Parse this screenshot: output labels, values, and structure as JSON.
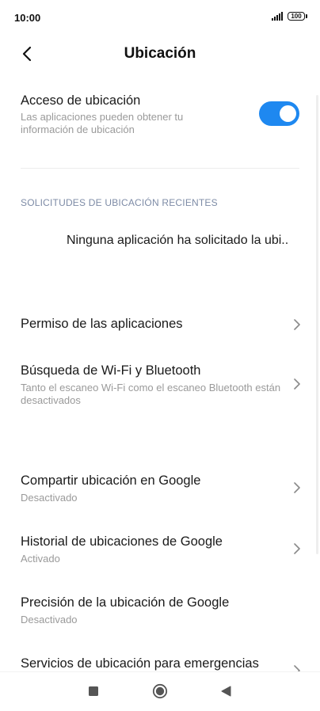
{
  "status_bar": {
    "time": "10:00",
    "battery": "100"
  },
  "header": {
    "title": "Ubicación",
    "back_icon": "back-arrow-icon"
  },
  "location_access": {
    "title": "Acceso de ubicación",
    "subtitle": "Las aplicaciones pueden obtener tu información de ubicación",
    "enabled": true,
    "accent_color": "#1e88f0"
  },
  "recent_requests": {
    "header": "SOLICITUDES DE UBICACIÓN RECIENTES",
    "empty_message": "Ninguna aplicación ha solicitado la ubi.."
  },
  "settings": [
    {
      "title": "Permiso de las aplicaciones",
      "subtitle": ""
    },
    {
      "title": "Búsqueda de Wi-Fi y Bluetooth",
      "subtitle": "Tanto el escaneo Wi-Fi como el escaneo Bluetooth están desactivados"
    },
    {
      "title": "Compartir ubicación en Google",
      "subtitle": "Desactivado"
    },
    {
      "title": "Historial de ubicaciones de Google",
      "subtitle": "Activado"
    },
    {
      "title": "Precisión de la ubicación de Google",
      "subtitle": "Desactivado"
    },
    {
      "title": "Servicios de ubicación para emergencias",
      "subtitle": ""
    }
  ],
  "navbar": {
    "recents_icon": "square-icon",
    "home_icon": "circle-icon",
    "back_icon": "triangle-back-icon"
  }
}
